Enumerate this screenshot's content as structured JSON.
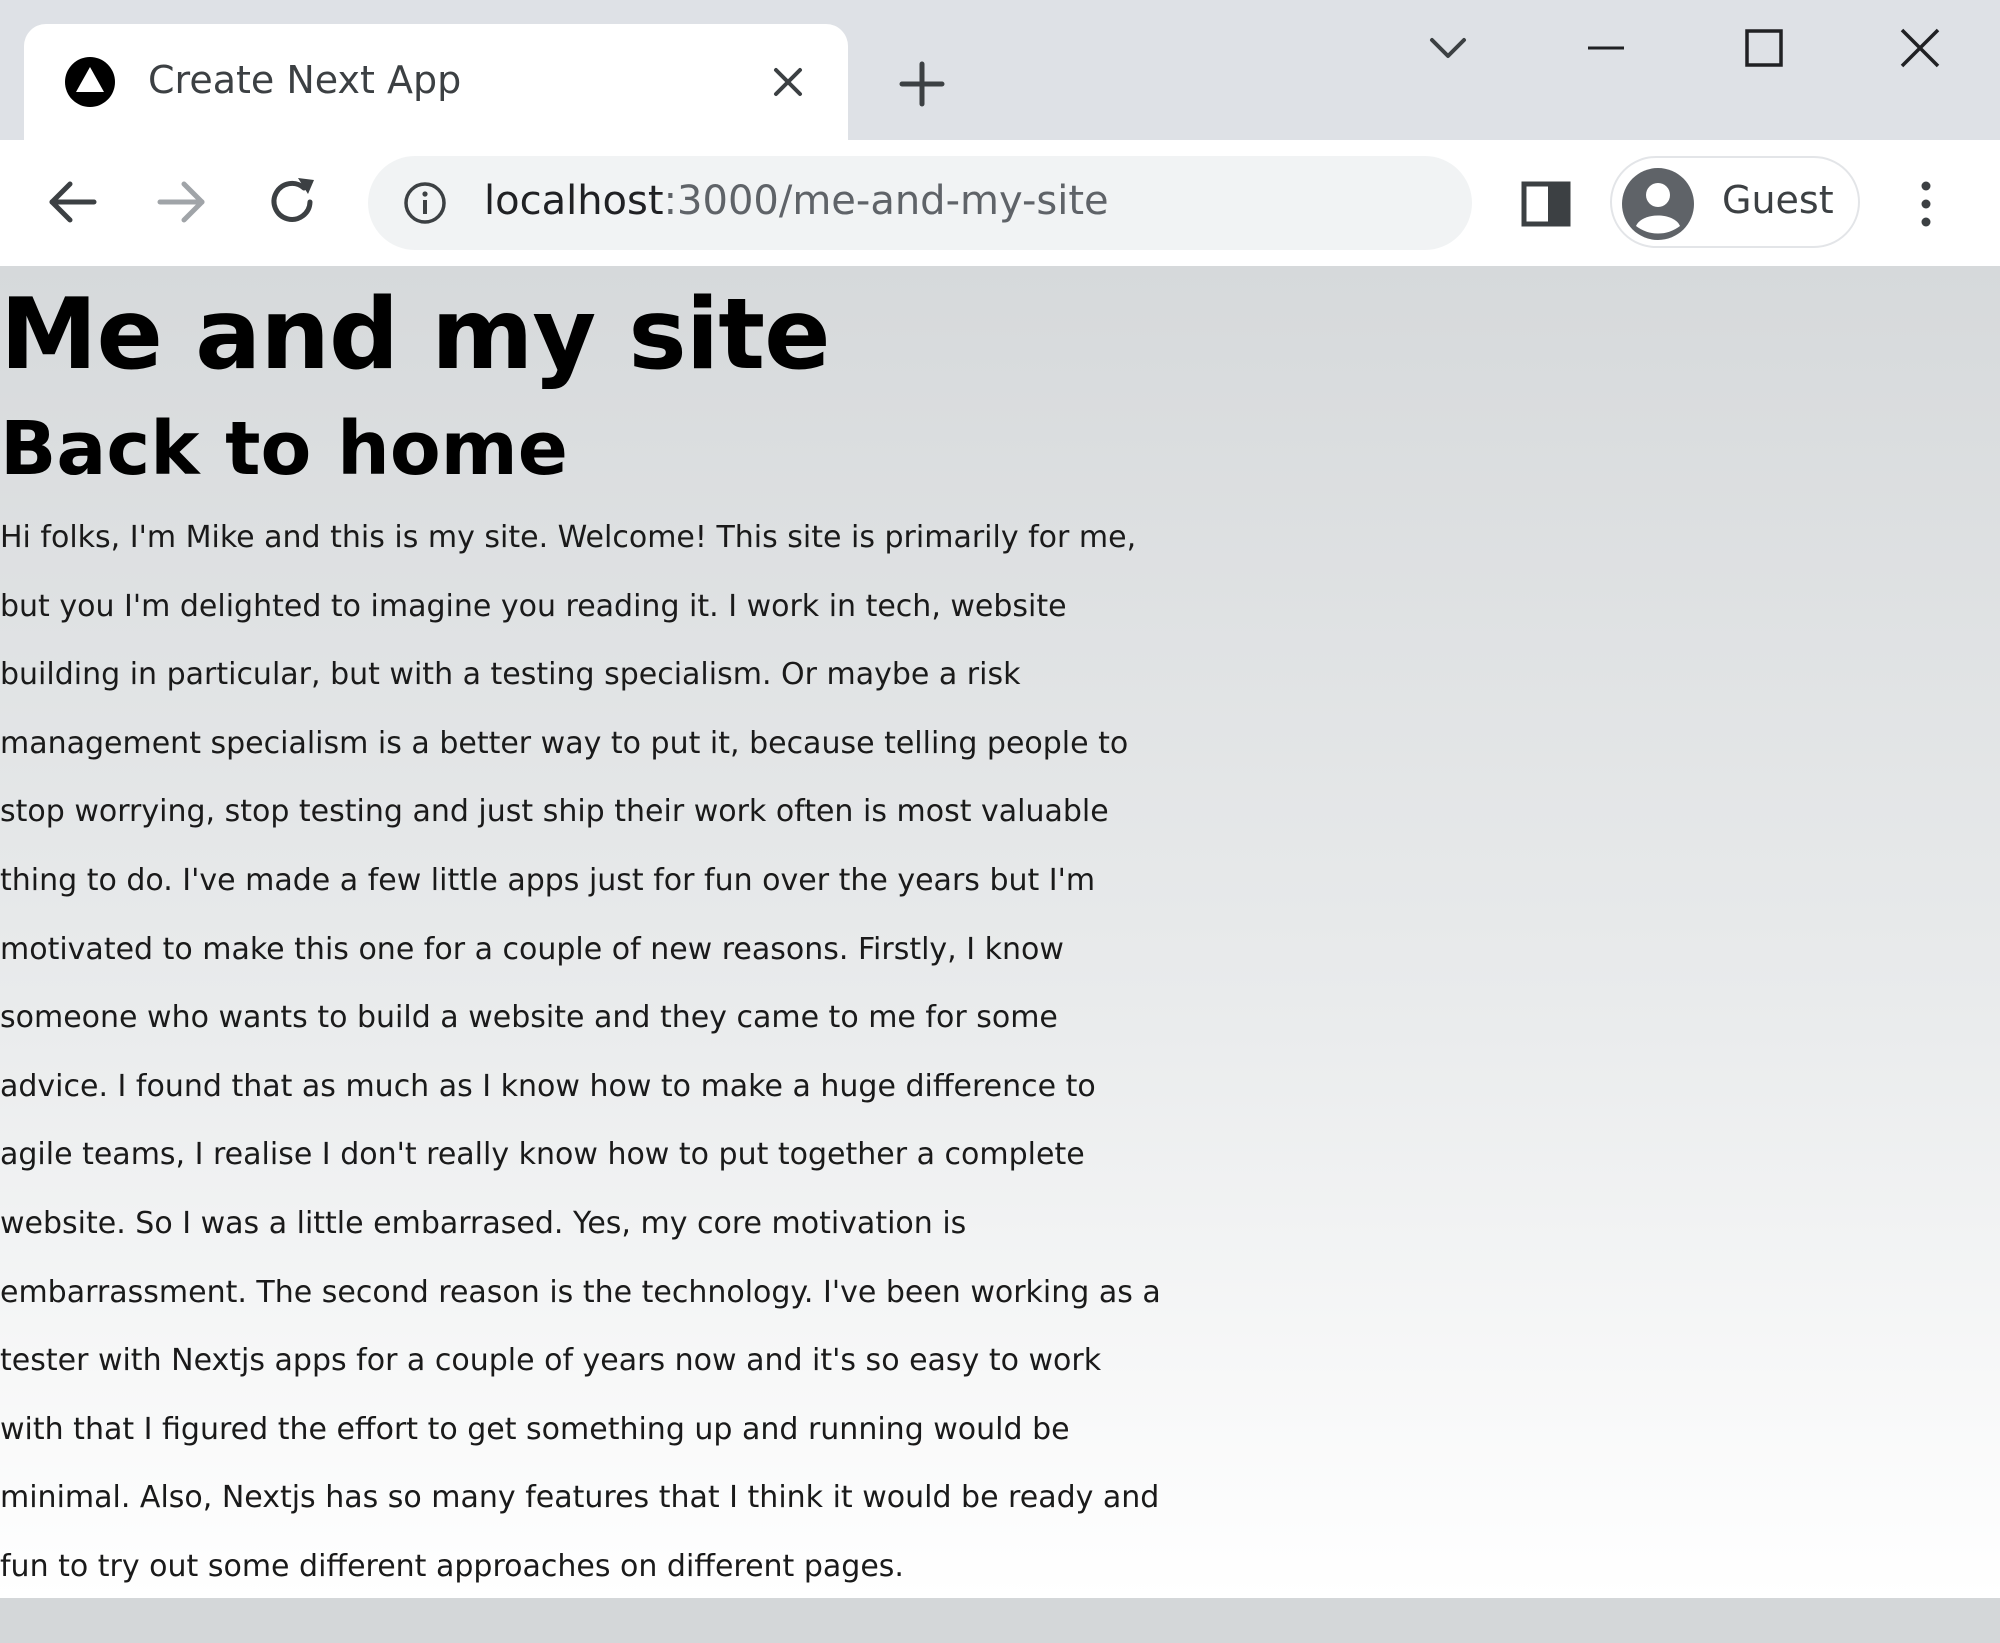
{
  "browser": {
    "tab": {
      "title": "Create Next App"
    },
    "address_bar": {
      "host": "localhost",
      "path": ":3000/me-and-my-site"
    },
    "profile": {
      "label": "Guest"
    }
  },
  "page": {
    "heading": "Me and my site",
    "back_link": "Back to home",
    "intro_lines": [
      "Hi folks, I'm Mike and this is my site. Welcome! This site is primarily for me,",
      "but you I'm delighted to imagine you reading it. I work in tech, website",
      "building in particular, but with a testing specialism. Or maybe a risk",
      "management specialism is a better way to put it, because telling people to",
      "stop worrying, stop testing and just ship their work often is most valuable",
      "thing to do. I've made a few little apps just for fun over the years but I'm",
      "motivated to make this one for a couple of new reasons. Firstly, I know",
      "someone who wants to build a website and they came to me for some",
      "advice. I found that as much as I know how to make a huge difference to",
      "agile teams, I realise I don't really know how to put together a complete",
      "website. So I was a little embarrased. Yes, my core motivation is",
      "embarrassment. The second reason is the technology. I've been working as a",
      "tester with Nextjs apps for a couple of years now and it's so easy to work",
      "with that I figured the effort to get something up and running would be",
      "minimal. Also, Nextjs has so many features that I think it would be ready and",
      "fun to try out some different approaches on different pages."
    ]
  },
  "icons": {
    "favicon": "nextjs-triangle-icon",
    "tab_close": "close-icon",
    "new_tab": "plus-icon",
    "tab_search": "chevron-down-icon",
    "minimize": "minimize-icon",
    "maximize": "maximize-icon",
    "window_close": "close-icon",
    "back": "arrow-left-icon",
    "forward": "arrow-right-icon",
    "reload": "reload-icon",
    "site_info": "info-icon",
    "side_panel": "side-panel-icon",
    "avatar": "person-icon",
    "menu": "kebab-menu-icon"
  },
  "colors": {
    "chrome_frame": "#dee1e6",
    "toolbar": "#ffffff",
    "omnibox": "#f1f3f4",
    "text": "#000000",
    "icon": "#5f6368"
  }
}
